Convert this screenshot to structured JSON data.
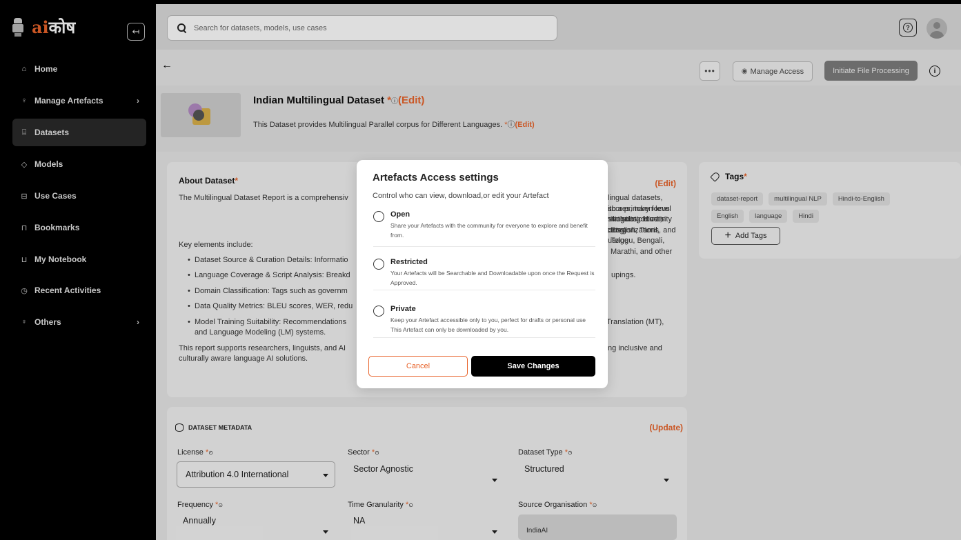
{
  "sidebar": {
    "logo_ai": "ai",
    "logo_hindi": "कोष",
    "collapse_icon": "↤",
    "items": [
      {
        "label": "Home",
        "icon": "⌂",
        "has_chevron": false
      },
      {
        "label": "Manage Artefacts",
        "icon": "♀",
        "has_chevron": true
      },
      {
        "label": "Datasets",
        "icon": "⌸",
        "has_chevron": false,
        "active": true
      },
      {
        "label": "Models",
        "icon": "◇",
        "has_chevron": false
      },
      {
        "label": "Use Cases",
        "icon": "⊟",
        "has_chevron": false
      },
      {
        "label": "Bookmarks",
        "icon": "⊓",
        "has_chevron": false
      },
      {
        "label": "My Notebook",
        "icon": "⊔",
        "has_chevron": false
      },
      {
        "label": "Recent Activities",
        "icon": "◷",
        "has_chevron": false
      },
      {
        "label": "Others",
        "icon": "♀",
        "has_chevron": true
      }
    ],
    "chevron": "›"
  },
  "topbar": {
    "search_placeholder": "Search for datasets, models, use cases",
    "help_icon": "?"
  },
  "toolbar": {
    "back": "←",
    "more": "•••",
    "manage_access_icon": "◉",
    "manage_access": "Manage Access",
    "initiate": "Initiate File Processing",
    "info": "i"
  },
  "dataset": {
    "title": "Indian Multilingual Dataset",
    "req": "*",
    "info": "ⓘ",
    "edit": "(Edit)",
    "description": "This Dataset provides Multilingual Parallel corpus for Different Languages.",
    "desc_req": "*",
    "desc_info": "ⓘ",
    "desc_edit": "(Edit)"
  },
  "about": {
    "title": "About Dataset",
    "req": "*",
    "edit": "(Edit)",
    "intro": "The Multilingual Dataset Report is a comprehensiv",
    "intro_b": "ltilingual datasets, with a primary focus on linguistic diversity across",
    "intro_c": "scores, token-level statistics, domain categorizations, and usage",
    "intro_d": "including Hindi, English, Tamil, Telugu, Bengali, Marathi, and other",
    "key_elements": "Key elements include:",
    "bullets": [
      "Dataset Source & Curation Details: Informatio",
      "Language Coverage & Script Analysis: Breakd",
      "Domain Classification: Tags such as governm",
      "Data Quality Metrics: BLEU scores, WER, redu",
      "Model Training Suitability: Recommendations"
    ],
    "bullet2_tail": "upings.",
    "bullet5_tail": "Translation (MT),",
    "bullet5_line2": "and Language Modeling (LM) systems.",
    "closing_a": "This report supports researchers, linguists, and AI",
    "closing_b": "ng inclusive and",
    "closing_c": "culturally aware language AI solutions."
  },
  "tags": {
    "title": "Tags",
    "req": "*",
    "items": [
      "dataset-report",
      "multilingual NLP",
      "Hindi-to-English",
      "English",
      "language",
      "Hindi"
    ],
    "add": "Add Tags",
    "add_icon": "+"
  },
  "metadata": {
    "heading": "DATASET METADATA",
    "update": "(Update)",
    "req": "*",
    "info": "⊙",
    "fields": {
      "license": {
        "label": "License",
        "value": "Attribution 4.0 International"
      },
      "sector": {
        "label": "Sector",
        "value": "Sector Agnostic"
      },
      "dataset_type": {
        "label": "Dataset Type",
        "value": "Structured"
      },
      "frequency": {
        "label": "Frequency",
        "value": "Annually"
      },
      "time_granularity": {
        "label": "Time Granularity",
        "value": "NA"
      },
      "source_org": {
        "label": "Source Organisation",
        "value": "IndiaAI"
      }
    }
  },
  "modal": {
    "title": "Artefacts Access settings",
    "subtitle": "Control who can view, download,or edit your Artefact",
    "options": [
      {
        "label": "Open",
        "desc": "Share your Artefacts with the community for everyone to explore and benefit from."
      },
      {
        "label": "Restricted",
        "desc": "Your Artefacts will be Searchable and Downloadable upon once the Request is Approved."
      },
      {
        "label": "Private",
        "desc": "Keep your Artefact accessible only to you, perfect for drafts or personal use This Artefact can only be downloaded by you."
      }
    ],
    "cancel": "Cancel",
    "save": "Save Changes"
  },
  "colors": {
    "accent": "#e8632a",
    "sidebar_bg": "#000000",
    "active_item": "#2a2a2a",
    "primary_button": "#000000"
  }
}
